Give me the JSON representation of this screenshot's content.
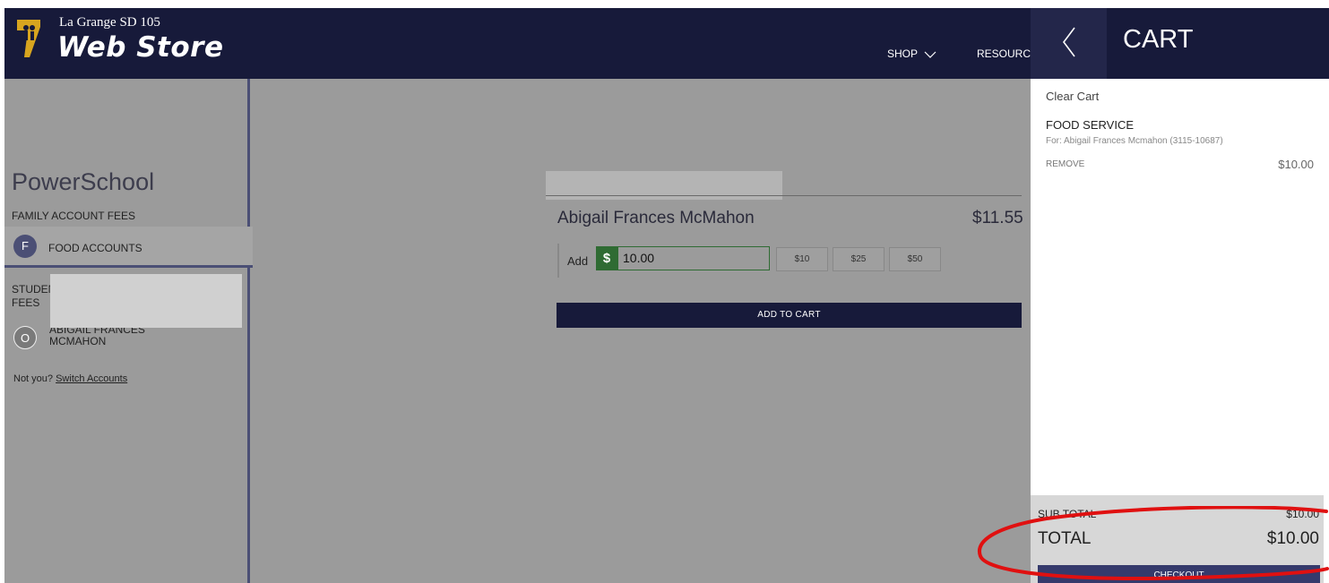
{
  "header": {
    "brand_small": "La Grange SD 105",
    "brand_big": "Web Store",
    "nav_shop": "SHOP",
    "nav_resources": "RESOURCES"
  },
  "sidebar": {
    "title": "PowerSchool",
    "family_fees_label": "FAMILY ACCOUNT FEES",
    "food_initial": "F",
    "food_label": "FOOD ACCOUNTS",
    "student_fees_label": "STUDENT FEES",
    "student_initial": "O",
    "student_name": "ABIGAIL FRANCES MCMAHON",
    "not_you": "Not you?",
    "switch_accounts": "Switch Accounts"
  },
  "main": {
    "student_name": "Abigail Frances McMahon",
    "balance": "$11.55",
    "add_label": "Add",
    "currency_symbol": "$",
    "amount_value": "10.00",
    "quick_amounts": [
      "$10",
      "$25",
      "$50"
    ],
    "add_to_cart": "ADD TO CART"
  },
  "cart": {
    "title": "CART",
    "clear_cart": "Clear Cart",
    "items": [
      {
        "title": "FOOD SERVICE",
        "for": "For: Abigail Frances Mcmahon (3115-10687)",
        "remove": "REMOVE",
        "price": "$10.00"
      }
    ],
    "subtotal_label": "SUB TOTAL",
    "subtotal_value": "$10.00",
    "total_label": "TOTAL",
    "total_value": "$10.00",
    "checkout": "CHECKOUT"
  },
  "colors": {
    "navy": "#171a3a",
    "accent_green": "#2f6b33",
    "annotation_red": "#e01010",
    "logo_gold": "#d8a51f"
  }
}
